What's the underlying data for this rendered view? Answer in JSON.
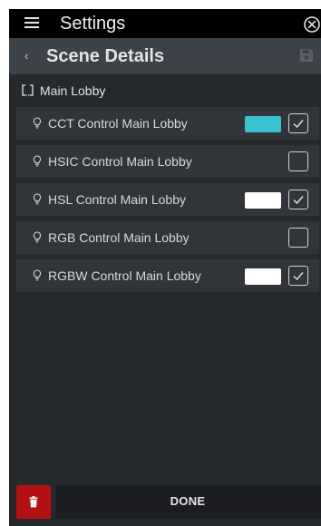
{
  "header": {
    "title": "Settings",
    "menu_icon": "hamburger-menu-icon",
    "close_icon": "close-circle-icon"
  },
  "subheader": {
    "title": "Scene Details",
    "back_icon": "chevron-left-icon",
    "back_glyph": "‹",
    "save_icon": "floppy-disk-icon"
  },
  "group": {
    "label": "Main Lobby",
    "icon": "group-bracket-icon"
  },
  "devices": [
    {
      "label": "CCT Control Main Lobby",
      "checked": true,
      "swatch_color": "#38c2cf",
      "icon": "bulb-icon"
    },
    {
      "label": "HSIC Control Main Lobby",
      "checked": false,
      "swatch_color": null,
      "icon": "bulb-icon"
    },
    {
      "label": "HSL Control Main Lobby",
      "checked": true,
      "swatch_color": "#ffffff",
      "icon": "bulb-icon"
    },
    {
      "label": "RGB Control Main Lobby",
      "checked": false,
      "swatch_color": null,
      "icon": "bulb-icon"
    },
    {
      "label": "RGBW Control Main Lobby",
      "checked": true,
      "swatch_color": "#ffffff",
      "icon": "bulb-icon"
    }
  ],
  "footer": {
    "done_label": "DONE",
    "trash_icon": "trash-icon"
  },
  "colors": {
    "background": "#26292c",
    "topbar": "#000000",
    "subheader": "#3c4248",
    "row": "#313539",
    "delete": "#b41117",
    "done_button": "#1b1d20"
  }
}
